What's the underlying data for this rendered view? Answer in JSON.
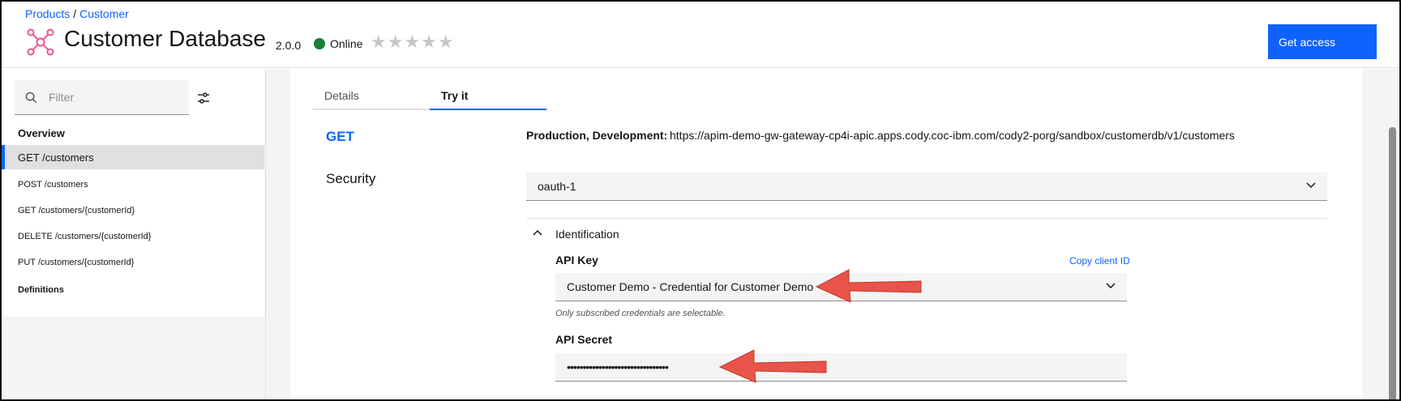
{
  "breadcrumb": {
    "products": "Products",
    "separator": "/",
    "customer": "Customer"
  },
  "product": {
    "title": "Customer Database",
    "version": "2.0.0",
    "status": "Online",
    "status_color": "#198038",
    "rating_stars": "★★★★★",
    "rating_value": 0,
    "rating_max": 5,
    "logo_icon": "api-network-icon",
    "logo_color": "#ee5396"
  },
  "header": {
    "get_access_label": "Get access"
  },
  "sidebar": {
    "filter_placeholder": "Filter",
    "overview_label": "Overview",
    "items": [
      {
        "label": "GET /customers",
        "active": true
      },
      {
        "label": "POST /customers"
      },
      {
        "label": "GET /customers/{customerId}"
      },
      {
        "label": "DELETE /customers/{customerId}"
      },
      {
        "label": "PUT /customers/{customerId}"
      }
    ],
    "definitions_label": "Definitions"
  },
  "tabs": [
    {
      "label": "Details"
    },
    {
      "label": "Try it",
      "active": true
    }
  ],
  "operation": {
    "method": "GET",
    "security_label": "Security",
    "environments_label": "Production, Development:",
    "url": "https://apim-demo-gw-gateway-cp4i-apic.apps.cody.coc-ibm.com/cody2-porg/sandbox/customerdb/v1/customers"
  },
  "security": {
    "selected_scheme": "oauth-1",
    "identification_label": "Identification",
    "api_key_label": "API Key",
    "copy_client_id": "Copy client ID",
    "api_key_value": "Customer Demo - Credential for Customer Demo",
    "helper_text": "Only subscribed credentials are selectable.",
    "api_secret_label": "API Secret",
    "api_secret_value": "••••••••••••••••••••••••••••••••"
  },
  "colors": {
    "accent": "#0f62fe",
    "annotation_arrow": "#e8534a"
  }
}
